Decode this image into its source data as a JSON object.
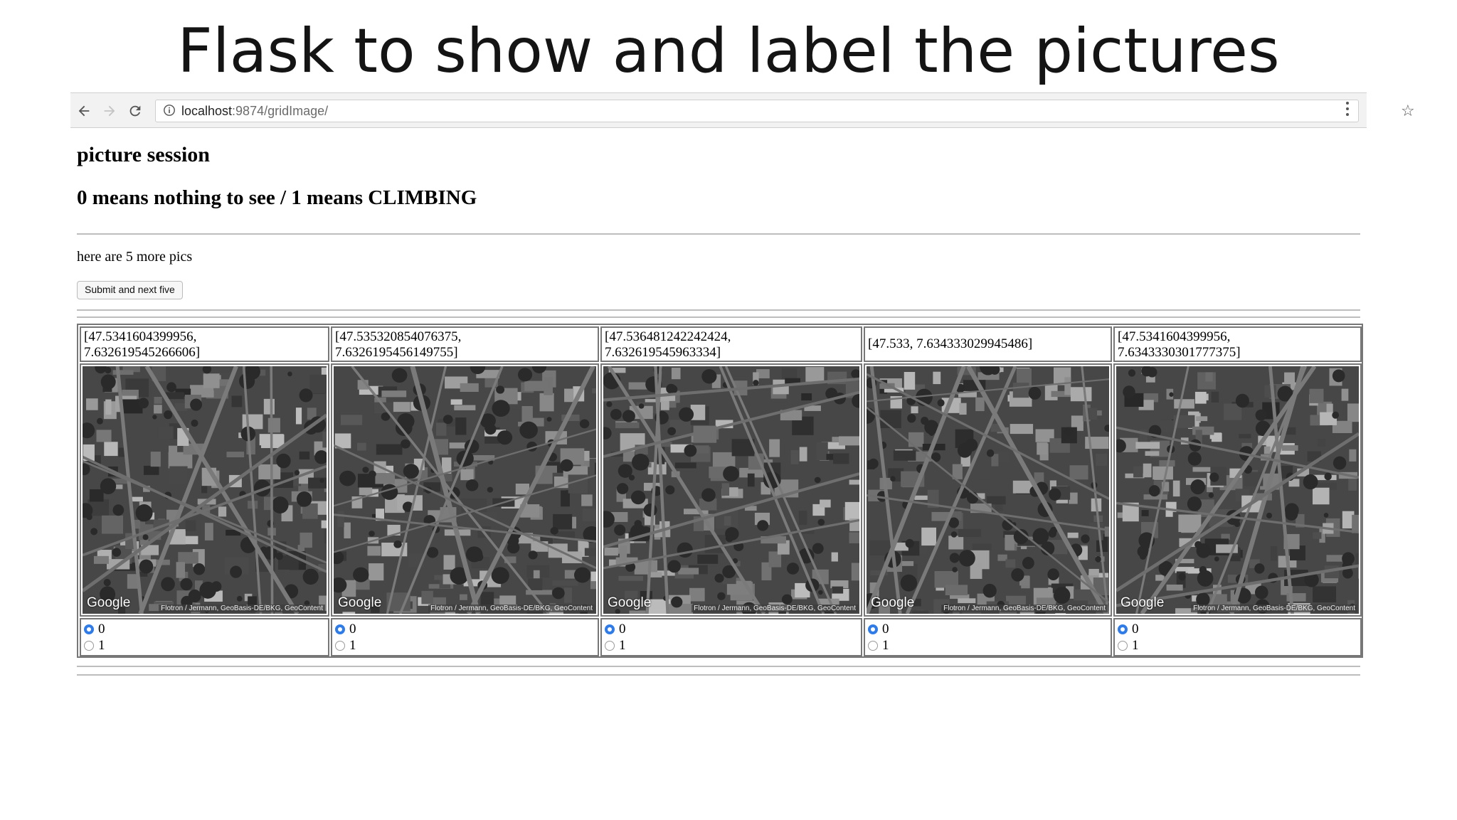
{
  "slide": {
    "title": "Flask to show and label the pictures"
  },
  "browser": {
    "url_host": "localhost",
    "url_path": ":9874/gridImage/",
    "back_icon": "back-arrow-icon",
    "forward_icon": "forward-arrow-icon",
    "reload_icon": "reload-icon",
    "bookmark_icon": "star-icon",
    "menu_icon": "kebab-menu-icon"
  },
  "page": {
    "heading": "picture session",
    "subheading": "0 means nothing to see / 1 means CLIMBING",
    "intro": "here are 5 more pics",
    "submit_label": "Submit and next five",
    "google_label": "Google",
    "attribution": "Flotron / Jermann, GeoBasis-DE/BKG, GeoContent",
    "radio_labels": [
      "0",
      "1"
    ],
    "selected_value": "0"
  },
  "pictures": [
    {
      "coord_line1": "[47.5341604399956,",
      "coord_line2": "7.632619545266606]"
    },
    {
      "coord_line1": "[47.535320854076375,",
      "coord_line2": "7.6326195456149755]"
    },
    {
      "coord_line1": "[47.536481242242424,",
      "coord_line2": "7.632619545963334]"
    },
    {
      "coord_line1": "[47.533, 7.634333029945486]",
      "coord_line2": ""
    },
    {
      "coord_line1": "[47.5341604399956,",
      "coord_line2": "7.6343330301777375]"
    }
  ]
}
